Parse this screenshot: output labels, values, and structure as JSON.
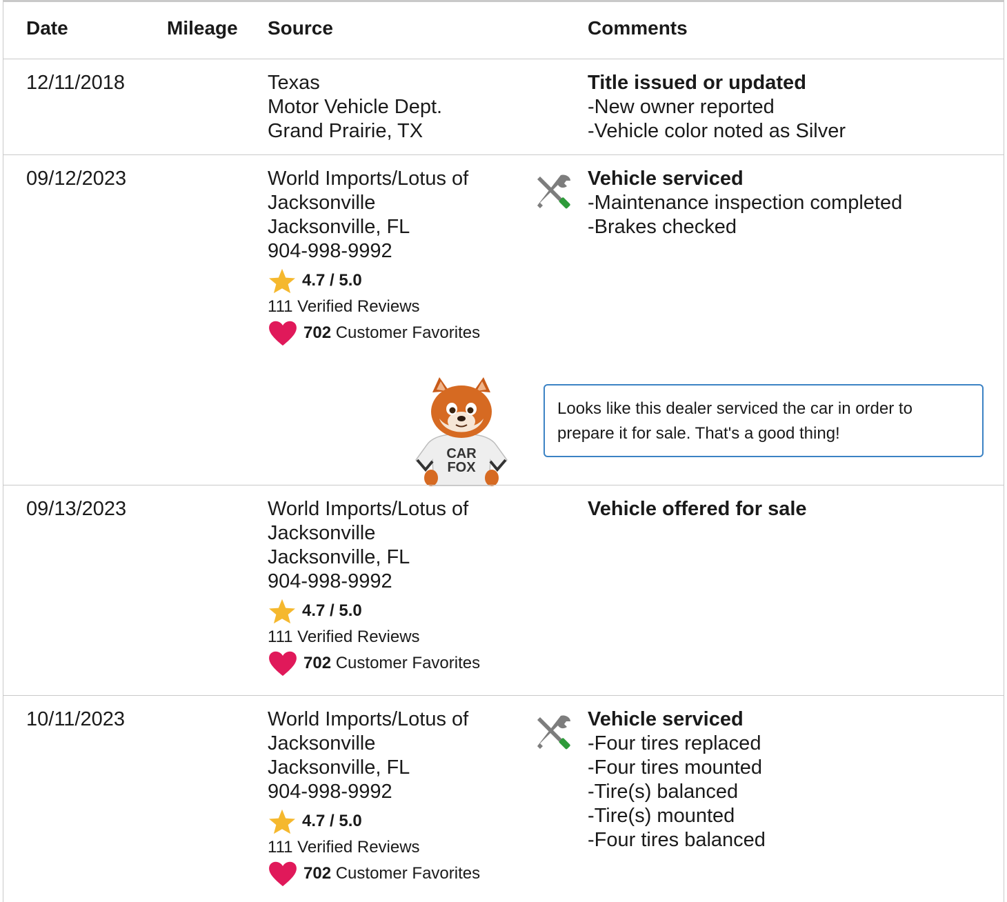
{
  "headers": {
    "date": "Date",
    "mileage": "Mileage",
    "source": "Source",
    "comments": "Comments"
  },
  "records": [
    {
      "date": "12/11/2018",
      "source_lines": [
        "Texas",
        "Motor Vehicle Dept.",
        "Grand Prairie, TX"
      ],
      "comment_title": "Title issued or updated",
      "comment_items": [
        "New owner reported",
        "Vehicle color noted as Silver"
      ]
    },
    {
      "date": "09/12/2023",
      "source_lines": [
        "World Imports/Lotus of",
        "Jacksonville",
        "Jacksonville, FL",
        "904-998-9992"
      ],
      "rating": "4.7 / 5.0",
      "reviews": "111 Verified Reviews",
      "favorites_count": "702",
      "favorites_label": "Customer Favorites",
      "icon": "service-tools-icon",
      "comment_title": "Vehicle serviced",
      "comment_items": [
        "Maintenance inspection completed",
        "Brakes checked"
      ],
      "callout": "Looks like this dealer serviced the car in order to prepare it for sale. That's a good thing!",
      "mascot_text": [
        "CAR",
        "FOX"
      ]
    },
    {
      "date": "09/13/2023",
      "source_lines": [
        "World Imports/Lotus of",
        "Jacksonville",
        "Jacksonville, FL",
        "904-998-9992"
      ],
      "rating": "4.7 / 5.0",
      "reviews": "111 Verified Reviews",
      "favorites_count": "702",
      "favorites_label": "Customer Favorites",
      "comment_title": "Vehicle offered for sale",
      "comment_items": []
    },
    {
      "date": "10/11/2023",
      "source_lines": [
        "World Imports/Lotus of",
        "Jacksonville",
        "Jacksonville, FL",
        "904-998-9992"
      ],
      "rating": "4.7 / 5.0",
      "reviews": "111 Verified Reviews",
      "favorites_count": "702",
      "favorites_label": "Customer Favorites",
      "icon": "service-tools-icon",
      "comment_title": "Vehicle serviced",
      "comment_items": [
        "Four tires replaced",
        "Four tires mounted",
        "Tire(s) balanced",
        "Tire(s) mounted",
        "Four tires balanced"
      ]
    }
  ],
  "colors": {
    "star": "#f5b82e",
    "heart": "#e0195a",
    "callout_border": "#3b82c4",
    "tool_handle": "#2e9b3a",
    "tool_metal": "#7d7d7d",
    "divider": "#c9c9c9"
  }
}
